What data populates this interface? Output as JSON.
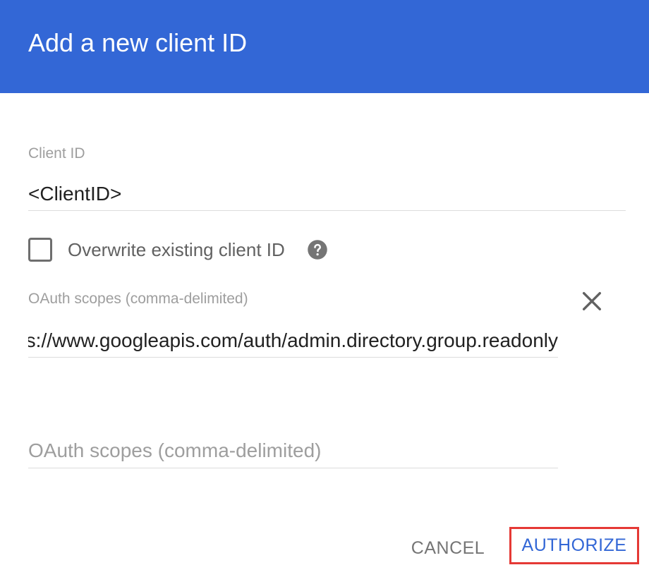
{
  "dialog": {
    "title": "Add a new client ID"
  },
  "client_id": {
    "label": "Client ID",
    "value": "<ClientID>"
  },
  "overwrite": {
    "label": "Overwrite existing client ID",
    "checked": false
  },
  "scopes": {
    "label": "OAuth scopes (comma-delimited)",
    "value_1": "https://www.googleapis.com/auth/admin.directory.group.readonly",
    "placeholder_2": "OAuth scopes (comma-delimited)"
  },
  "actions": {
    "cancel_label": "CANCEL",
    "authorize_label": "AUTHORIZE"
  },
  "colors": {
    "header_bg": "#3367d6",
    "accent": "#3367d6",
    "highlight_border": "#e53935"
  },
  "icons": {
    "help": "help-circle-icon",
    "remove": "close-icon"
  }
}
